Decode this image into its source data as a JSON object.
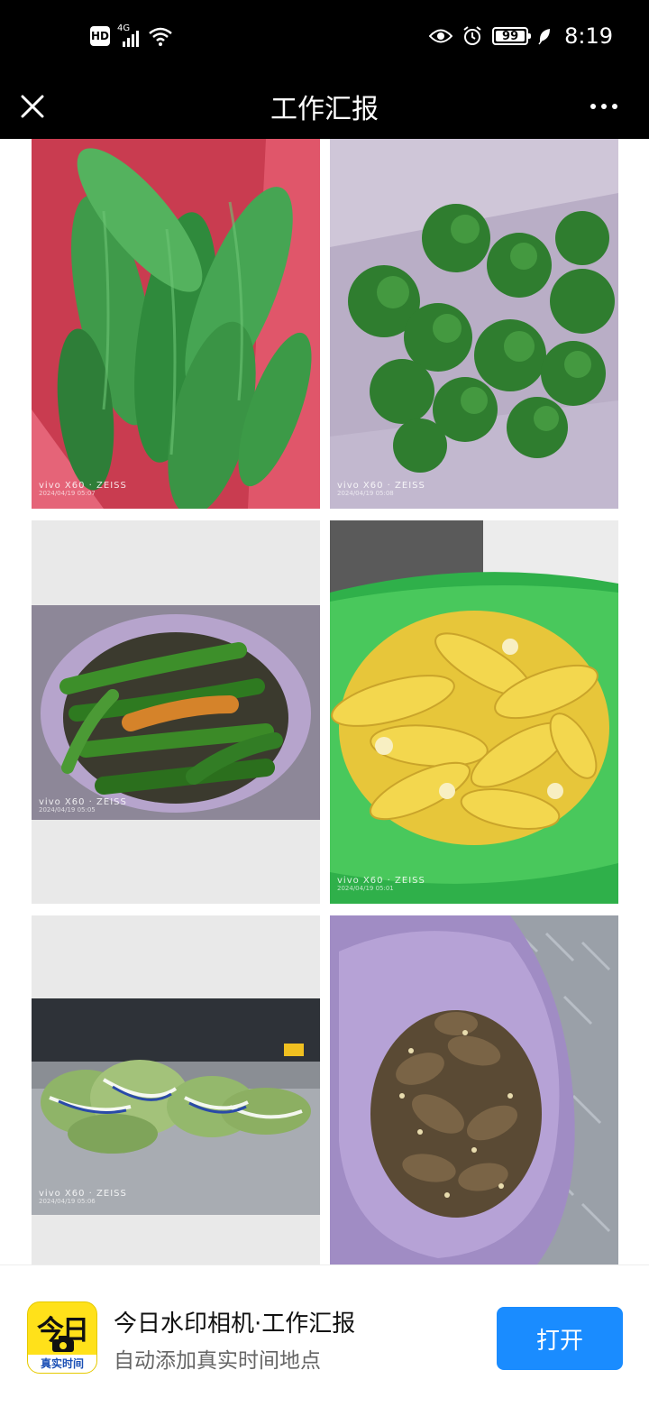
{
  "status_bar": {
    "hd": "HD",
    "network": "4G",
    "battery": "99",
    "time": "8:19"
  },
  "header": {
    "title": "工作汇报",
    "close_icon": "close-icon",
    "more_icon": "more-icon"
  },
  "photos": [
    {
      "subject": "bitter-melon",
      "watermark_brand": "vivo X60 · ZEISS",
      "watermark_date": "2024/04/19 05:07"
    },
    {
      "subject": "green-peppers",
      "watermark_brand": "vivo X60 · ZEISS",
      "watermark_date": "2024/04/19 05:08"
    },
    {
      "subject": "green-chilies",
      "watermark_brand": "vivo X60 · ZEISS",
      "watermark_date": "2024/04/19 05:05"
    },
    {
      "subject": "corn",
      "watermark_brand": "vivo X60 · ZEISS",
      "watermark_date": "2024/04/19 05:01"
    },
    {
      "subject": "bagged-greens",
      "watermark_brand": "vivo X60 · ZEISS",
      "watermark_date": "2024/04/19 05:06"
    },
    {
      "subject": "yams",
      "watermark_brand": "",
      "watermark_date": ""
    }
  ],
  "banner": {
    "icon_top": "今日",
    "icon_bottom": "真实时间",
    "app_name": "今日水印相机·工作汇报",
    "subtitle": "自动添加真实时间地点",
    "open_label": "打开"
  }
}
